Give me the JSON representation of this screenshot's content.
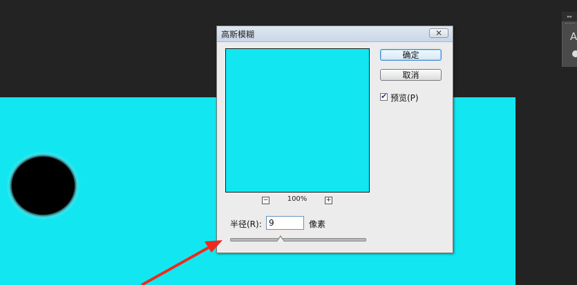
{
  "dialog": {
    "title": "高斯模糊",
    "close_icon": "close-icon",
    "ok_label": "确定",
    "cancel_label": "取消",
    "preview_label": "预览(P)",
    "preview_checked": true,
    "zoom_level": "100%",
    "zoom_out_icon": "−",
    "zoom_in_icon": "+",
    "radius_label": "半径(R):",
    "radius_value": "9",
    "unit_label": "像素",
    "slider_fraction": 0.37
  },
  "side_panel": {
    "letter": "A"
  },
  "colors": {
    "canvas": "#12e6f0",
    "background": "#232323",
    "annotation_arrow": "#ee2a1f"
  }
}
